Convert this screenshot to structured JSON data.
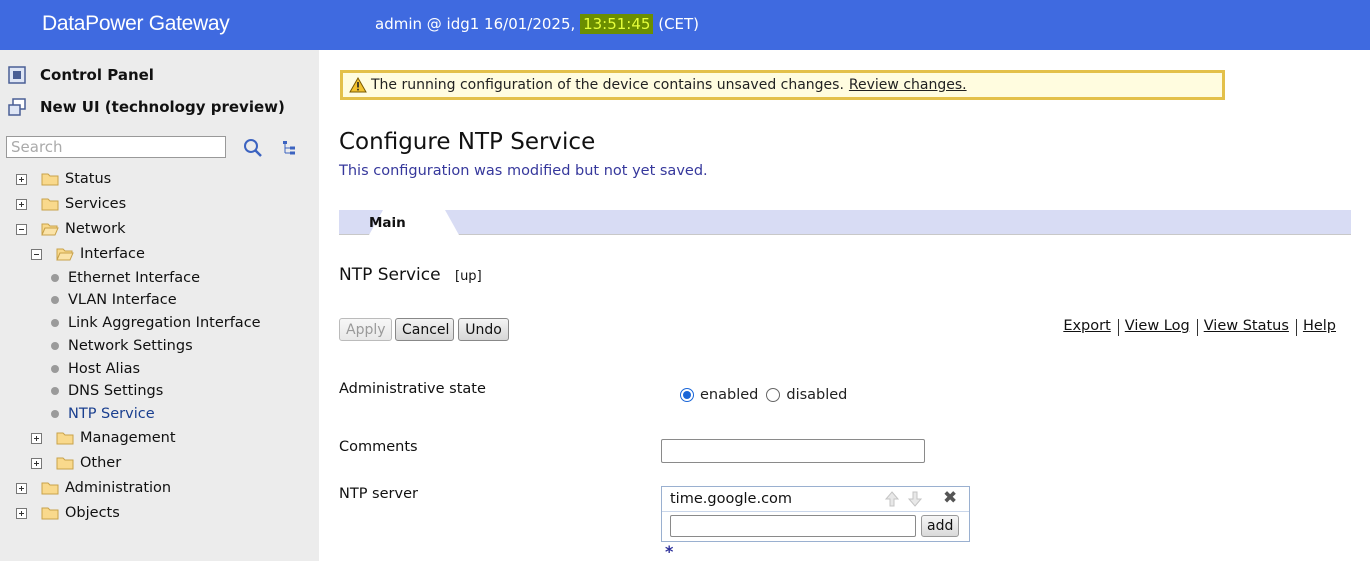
{
  "header": {
    "brand": "DataPower Gateway",
    "session_prefix": "admin @ idg1 16/01/2025,",
    "time": "13:51:45",
    "timezone": "(CET)",
    "color": "#3f6ae0"
  },
  "sidebar": {
    "control_panel": "Control Panel",
    "new_ui": "New UI (technology preview)",
    "search_placeholder": "Search",
    "tree": {
      "status": "Status",
      "services": "Services",
      "network": "Network",
      "interface": "Interface",
      "ethernet": "Ethernet Interface",
      "vlan": "VLAN Interface",
      "link_agg": "Link Aggregation Interface",
      "network_settings": "Network Settings",
      "host_alias": "Host Alias",
      "dns": "DNS Settings",
      "ntp": "NTP Service",
      "management": "Management",
      "other": "Other",
      "administration": "Administration",
      "objects": "Objects"
    }
  },
  "main": {
    "warning_text": "The running configuration of the device contains unsaved changes.",
    "warning_link": "Review changes.",
    "title": "Configure NTP Service",
    "modified_note": "This configuration was modified but not yet saved.",
    "tab_main": "Main",
    "section_title": "NTP Service",
    "section_status": "[up]",
    "buttons": {
      "apply": "Apply",
      "cancel": "Cancel",
      "undo": "Undo"
    },
    "links": {
      "export": "Export",
      "view_log": "View Log",
      "view_status": "View Status",
      "help": "Help"
    },
    "fields": {
      "admin_state_label": "Administrative state",
      "enabled": "enabled",
      "disabled": "disabled",
      "admin_state_value": "enabled",
      "comments_label": "Comments",
      "comments_value": "",
      "ntp_server_label": "NTP server",
      "ntp_servers": [
        "time.google.com"
      ],
      "new_server_value": "",
      "add_label": "add",
      "required_marker": "*"
    }
  }
}
